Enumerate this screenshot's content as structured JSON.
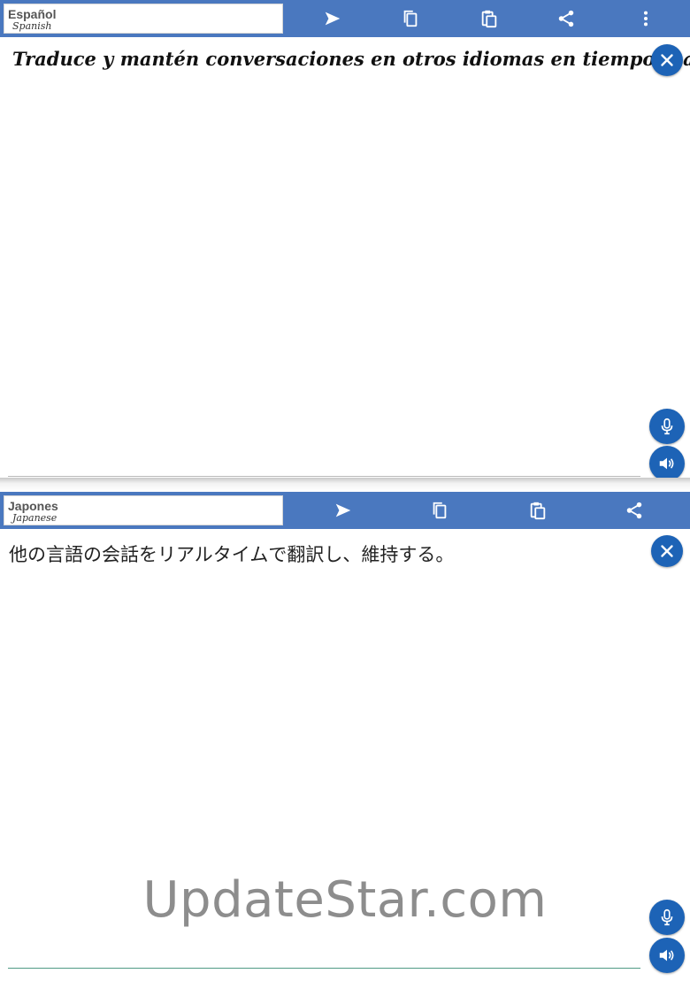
{
  "source_panel": {
    "language_name": "Español",
    "language_subtitle": "Spanish",
    "text": "Traduce y mantén conversaciones en otros idiomas en tiempo real."
  },
  "target_panel": {
    "language_name": "Japones",
    "language_subtitle": "Japanese",
    "text": "他の言語の会話をリアルタイムで翻訳し、維持する。"
  },
  "watermark": "UpdateStar.com",
  "colors": {
    "toolbar": "#4a78bf",
    "button": "#1d63b6",
    "icon": "#ffffff"
  },
  "icons": {
    "translate": "send-arrow-icon",
    "copy": "copy-icon",
    "paste": "paste-icon",
    "share": "share-icon",
    "menu": "more-vert-icon",
    "clear": "close-icon",
    "mic": "microphone-icon",
    "speaker": "speaker-icon"
  }
}
